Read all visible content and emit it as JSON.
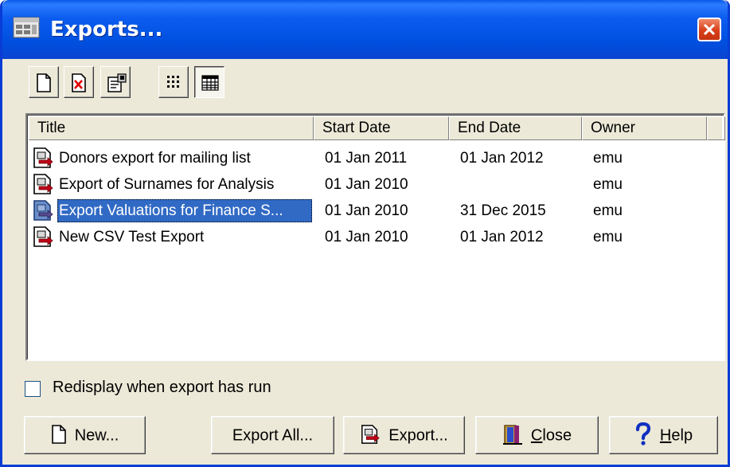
{
  "window": {
    "title": "Exports...",
    "icon": "exports-app-icon",
    "close_icon": "close-icon"
  },
  "toolbar": {
    "buttons": [
      {
        "name": "new-document-icon"
      },
      {
        "name": "delete-document-icon"
      },
      {
        "name": "properties-icon"
      },
      {
        "name": "icon-view-icon"
      },
      {
        "name": "details-view-icon",
        "pressed": true
      }
    ]
  },
  "list": {
    "columns": [
      "Title",
      "Start Date",
      "End Date",
      "Owner"
    ],
    "rows": [
      {
        "title": "Donors export for mailing list",
        "start": "01 Jan 2011",
        "end": "01 Jan 2012",
        "owner": "emu"
      },
      {
        "title": "Export of Surnames for Analysis",
        "start": "01 Jan 2010",
        "end": "",
        "owner": "emu"
      },
      {
        "title": "Export Valuations for Finance S...",
        "start": "01 Jan 2010",
        "end": "31 Dec 2015",
        "owner": "emu",
        "selected": true
      },
      {
        "title": "New CSV Test Export",
        "start": "01 Jan 2010",
        "end": "01 Jan 2012",
        "owner": "emu"
      }
    ]
  },
  "options": {
    "redisplay_label": "Redisplay when export has run",
    "redisplay_checked": false
  },
  "buttons": {
    "new": "New...",
    "export_all": "Export All...",
    "export": "Export...",
    "close_prefix": "",
    "close_u": "C",
    "close_rest": "lose",
    "help_u": "H",
    "help_rest": "elp"
  },
  "colors": {
    "titlebar": "#0054e3",
    "selection": "#316ac5",
    "face": "#ece9d8"
  }
}
